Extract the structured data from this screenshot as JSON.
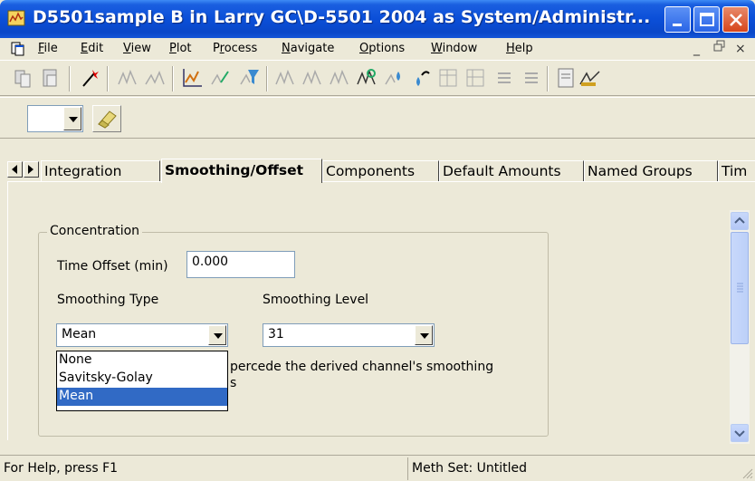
{
  "window": {
    "title": "D5501sample B in Larry GC\\D-5501 2004 as System/Administr..."
  },
  "menu": {
    "items": [
      {
        "pre": "",
        "u": "F",
        "post": "ile"
      },
      {
        "pre": "",
        "u": "E",
        "post": "dit"
      },
      {
        "pre": "",
        "u": "V",
        "post": "iew"
      },
      {
        "pre": "",
        "u": "P",
        "post": "lot"
      },
      {
        "pre": "P",
        "u": "r",
        "post": "ocess"
      },
      {
        "pre": "",
        "u": "N",
        "post": "avigate"
      },
      {
        "pre": "",
        "u": "O",
        "post": "ptions"
      },
      {
        "pre": "",
        "u": "W",
        "post": "indow"
      },
      {
        "pre": "",
        "u": "H",
        "post": "elp"
      }
    ],
    "mdi_minimize": "_",
    "mdi_restore": " ",
    "mdi_close": "×"
  },
  "tabs": [
    "Integration",
    "Smoothing/Offset",
    "Components",
    "Default Amounts",
    "Named Groups",
    "Tim"
  ],
  "active_tab": "Smoothing/Offset",
  "concentration": {
    "group_label": "Concentration",
    "time_offset_label": "Time Offset (min)",
    "time_offset_value": "0.000",
    "smoothing_type_label": "Smoothing Type",
    "smoothing_type_value": "Mean",
    "smoothing_type_options": [
      "None",
      "Savitsky-Golay",
      "Mean"
    ],
    "smoothing_level_label": "Smoothing Level",
    "smoothing_level_value": "31",
    "checkbox_text_line1": "percede the derived channel's smoothing",
    "checkbox_text_line2": "s"
  },
  "status": {
    "help": "For Help, press F1",
    "meth_set": "Meth Set: Untitled"
  },
  "colors": {
    "title_bar": "#0b4fd8",
    "selection": "#316ac5",
    "face": "#ece9d8"
  }
}
